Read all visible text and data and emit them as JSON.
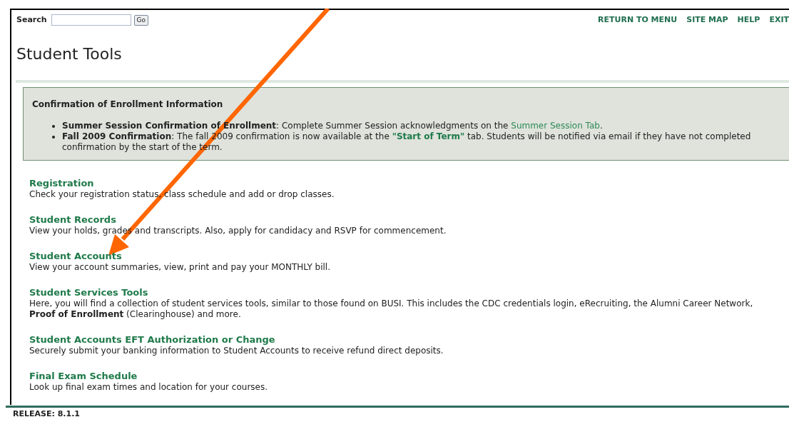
{
  "search": {
    "label": "Search",
    "button": "Go"
  },
  "nav_links": [
    "RETURN TO MENU",
    "SITE MAP",
    "HELP",
    "EXIT"
  ],
  "title": "Student Tools",
  "notice": {
    "title": "Confirmation of Enrollment Information",
    "items": [
      {
        "parts": [
          {
            "kind": "text",
            "text": "**Summer Session Confirmation of Enrollment**: Complete Summer Session acknowledgments on the "
          },
          {
            "kind": "link",
            "text": "Summer Session Tab"
          },
          {
            "kind": "text",
            "text": "."
          }
        ]
      },
      {
        "parts": [
          {
            "kind": "text",
            "text": "**Fall 2009 Confirmation**: The fall 2009 confirmation is now available at the "
          },
          {
            "kind": "bold_link",
            "text": "\"Start of Term\""
          },
          {
            "kind": "text",
            "text": " tab. Students will be notified via email if they have not completed confirmation by the start of the term."
          }
        ]
      }
    ]
  },
  "sections": [
    {
      "title": "Registration",
      "description": "Check your registration status, class schedule and add or drop classes."
    },
    {
      "title": "Student Records",
      "description": "View your holds, grades and transcripts. Also, apply for candidacy and RSVP for commencement."
    },
    {
      "title": "Student Accounts",
      "description": "View your account summaries, view, print and pay your MONTHLY bill."
    },
    {
      "title": "Student Services Tools",
      "description": "Here, you will find a collection of student services tools, similar to those found on BUSI. This includes the CDC credentials login, eRecruiting, the Alumni Career Network, **Proof of Enrollment** (Clearinghouse) and more."
    },
    {
      "title": "Student Accounts EFT Authorization or Change",
      "description": "Securely submit your banking information to Student Accounts to receive refund direct deposits."
    },
    {
      "title": "Final Exam Schedule",
      "description": "Look up final exam times and location for your courses."
    }
  ],
  "release": "RELEASE: 8.1.1",
  "annotation": {
    "kind": "arrow"
  }
}
